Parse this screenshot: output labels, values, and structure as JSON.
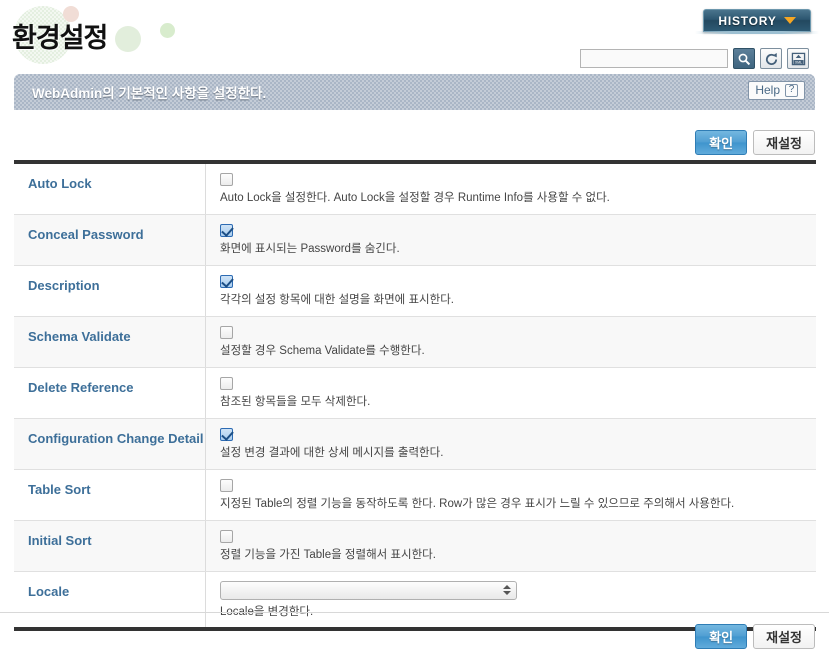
{
  "header": {
    "title": "환경설정",
    "history_label": "HISTORY",
    "history_icon": "chevron-down-icon",
    "search": {
      "value": "",
      "placeholder": ""
    },
    "icons": [
      "search-icon",
      "refresh-icon",
      "xml-export-icon"
    ]
  },
  "banner": {
    "text": "WebAdmin의 기본적인 사항을 설정한다.",
    "help_label": "Help",
    "help_icon": "question-mark-icon"
  },
  "actions": {
    "confirm_label": "확인",
    "reset_label": "재설정"
  },
  "colors": {
    "accent_blue": "#4f9ed2",
    "label_blue": "#3d6f99",
    "banner_gray": "#aab6c6",
    "history_teal": "#2c5670",
    "chevron_orange": "#f5a623",
    "table_border": "#333333"
  },
  "settings": {
    "rows": [
      {
        "label": "Auto Lock",
        "control": "checkbox",
        "checked": false,
        "description": "Auto Lock을 설정한다. Auto Lock을 설정할 경우 Runtime Info를 사용할 수 없다."
      },
      {
        "label": "Conceal Password",
        "control": "checkbox",
        "checked": true,
        "description": "화면에 표시되는 Password를 숨긴다."
      },
      {
        "label": "Description",
        "control": "checkbox",
        "checked": true,
        "description": "각각의 설정 항목에 대한 설명을 화면에 표시한다."
      },
      {
        "label": "Schema Validate",
        "control": "checkbox",
        "checked": false,
        "description": "설정할 경우 Schema Validate를 수행한다."
      },
      {
        "label": "Delete Reference",
        "control": "checkbox",
        "checked": false,
        "description": "참조된 항목들을 모두 삭제한다."
      },
      {
        "label": "Configuration Change Detail",
        "control": "checkbox",
        "checked": true,
        "description": "설정 변경 결과에 대한 상세 메시지를 출력한다."
      },
      {
        "label": "Table Sort",
        "control": "checkbox",
        "checked": false,
        "description": "지정된 Table의 정렬 기능을 동작하도록 한다. Row가 많은 경우 표시가 느릴 수 있으므로 주의해서 사용한다."
      },
      {
        "label": "Initial Sort",
        "control": "checkbox",
        "checked": false,
        "description": "정렬 기능을 가진 Table을 정렬해서 표시한다."
      },
      {
        "label": "Locale",
        "control": "select",
        "value": "",
        "description": "Locale을 변경한다."
      }
    ]
  }
}
